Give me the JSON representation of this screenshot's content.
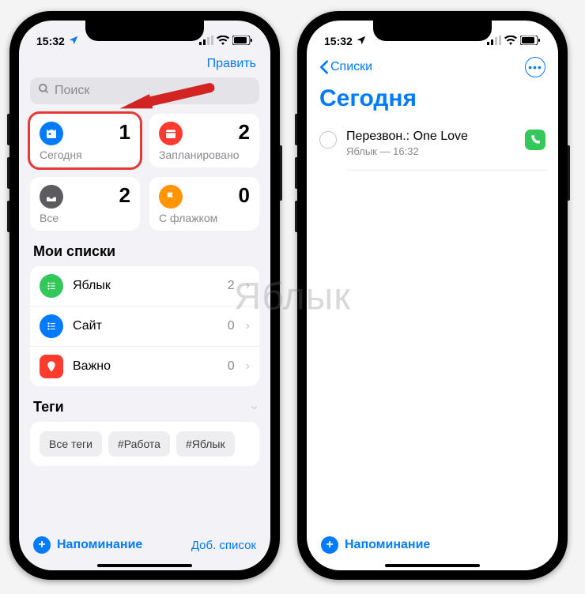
{
  "status": {
    "time": "15:32"
  },
  "left": {
    "edit": "Править",
    "search_placeholder": "Поиск",
    "cards": {
      "today": {
        "count": "1",
        "label": "Сегодня",
        "color": "#007aff"
      },
      "scheduled": {
        "count": "2",
        "label": "Запланировано",
        "color": "#ff3b30"
      },
      "all": {
        "count": "2",
        "label": "Все",
        "color": "#5b5b60"
      },
      "flagged": {
        "count": "0",
        "label": "С флажком",
        "color": "#ff9500"
      }
    },
    "my_lists_title": "Мои списки",
    "lists": [
      {
        "label": "Яблык",
        "count": "2",
        "color": "#34c759"
      },
      {
        "label": "Сайт",
        "count": "0",
        "color": "#007aff"
      },
      {
        "label": "Важно",
        "count": "0",
        "color": "#ff3b30"
      }
    ],
    "tags_title": "Теги",
    "tags": [
      "Все теги",
      "#Работа",
      "#Яблык"
    ],
    "new_reminder": "Напоминание",
    "add_list": "Доб. список"
  },
  "right": {
    "back": "Списки",
    "title": "Сегодня",
    "reminder": {
      "title": "Перезвон.: One Love",
      "subtitle": "Яблык — 16:32"
    },
    "new_reminder": "Напоминание"
  },
  "watermark": "Яблык"
}
